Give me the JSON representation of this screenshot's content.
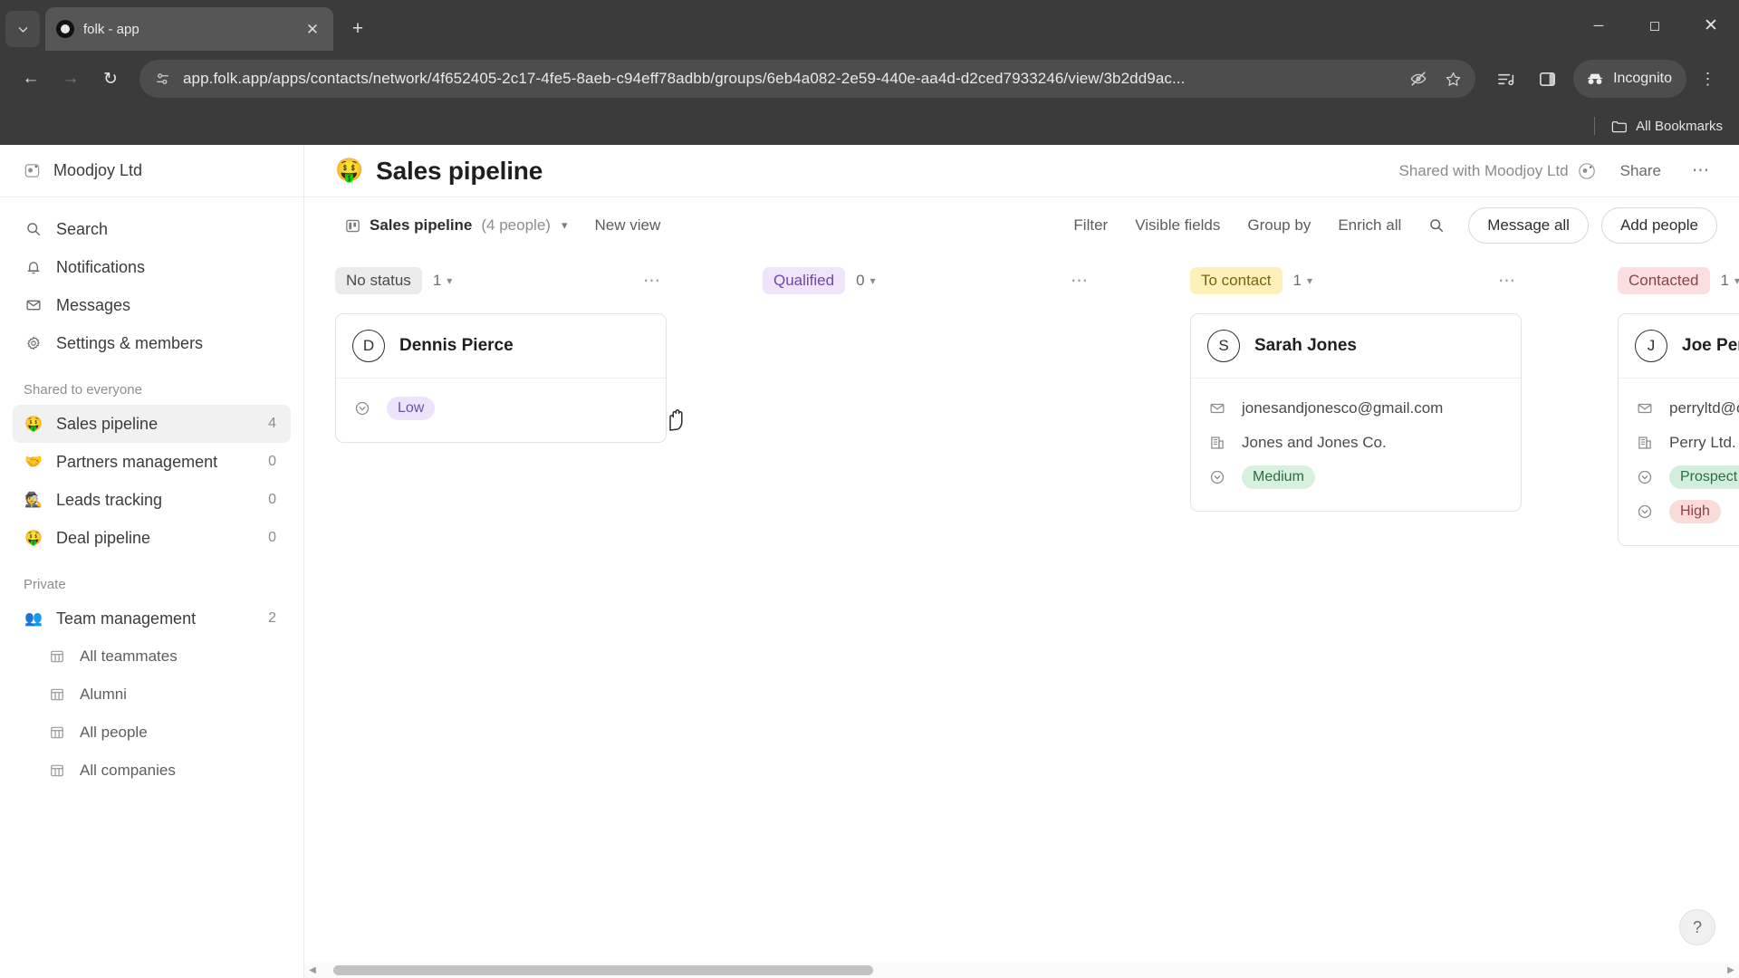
{
  "browser": {
    "tab": {
      "title": "folk - app",
      "favicon_icon": "folk-logo-icon",
      "close_icon": "close-icon"
    },
    "tab_search_icon": "tab-search-chevron-icon",
    "new_tab_icon": "plus-icon",
    "window_controls": {
      "minimize": "minimize-icon",
      "maximize": "maximize-icon",
      "close": "close-icon"
    },
    "nav": {
      "back_icon": "back-arrow-icon",
      "forward_icon": "forward-arrow-icon",
      "reload_icon": "reload-icon"
    },
    "omnibox": {
      "site_info_icon": "page-settings-icon",
      "url": "app.folk.app/apps/contacts/network/4f652405-2c17-4fe5-8aeb-c94eff78adbb/groups/6eb4a082-2e59-440e-aa4d-d2ced7933246/view/3b2dd9ac...",
      "hide_icon": "eye-crossed-icon",
      "bookmark_icon": "star-icon"
    },
    "toolbar_icons": [
      "reading-list-icon",
      "side-panel-icon"
    ],
    "incognito": {
      "label": "Incognito",
      "icon": "incognito-hat-icon"
    },
    "menu_icon": "three-dot-menu-icon",
    "bookmarks_bar": {
      "label": "All Bookmarks",
      "icon": "folder-icon"
    }
  },
  "sidebar": {
    "workspace": {
      "name": "Moodjoy Ltd",
      "logo_icon": "moodjoy-logo-icon"
    },
    "nav": [
      {
        "label": "Search",
        "icon": "search-icon"
      },
      {
        "label": "Notifications",
        "icon": "bell-icon"
      },
      {
        "label": "Messages",
        "icon": "envelope-icon"
      },
      {
        "label": "Settings & members",
        "icon": "gear-icon"
      }
    ],
    "sections": [
      {
        "title": "Shared to everyone",
        "items": [
          {
            "label": "Sales pipeline",
            "emoji": "🤑",
            "count": "4",
            "active": true
          },
          {
            "label": "Partners management",
            "emoji": "🤝",
            "count": "0",
            "active": false
          },
          {
            "label": "Leads tracking",
            "emoji": "🕵️",
            "count": "0",
            "active": false
          },
          {
            "label": "Deal pipeline",
            "emoji": "🤑",
            "count": "0",
            "active": false
          }
        ]
      },
      {
        "title": "Private",
        "items": [
          {
            "label": "Team management",
            "emoji": "👥",
            "count": "2",
            "active": false
          }
        ],
        "subitems": [
          {
            "label": "All teammates",
            "icon": "table-icon"
          },
          {
            "label": "Alumni",
            "icon": "table-icon"
          },
          {
            "label": "All people",
            "icon": "table-icon"
          },
          {
            "label": "All companies",
            "icon": "table-icon"
          }
        ]
      }
    ]
  },
  "header": {
    "emoji": "🤑",
    "title": "Sales pipeline",
    "shared_with": "Shared with Moodjoy Ltd",
    "shared_avatar_emoji": "👤",
    "share_label": "Share",
    "more_icon": "three-dot-menu-icon"
  },
  "toolbar": {
    "view_icon": "board-view-icon",
    "view_name": "Sales pipeline",
    "view_count": "(4 people)",
    "view_caret_icon": "chevron-down-icon",
    "new_view_label": "New view",
    "links": [
      "Filter",
      "Visible fields",
      "Group by",
      "Enrich all"
    ],
    "search_icon": "search-icon",
    "message_all_label": "Message all",
    "add_people_label": "Add people"
  },
  "board": {
    "columns": [
      {
        "status": "No status",
        "status_bg": "#ebebeb",
        "status_fg": "#4a4a4a",
        "count": "1",
        "caret_icon": "chevron-down-icon",
        "more_icon": "three-dot-menu-icon",
        "cards": [
          {
            "initial": "D",
            "name": "Dennis Pierce",
            "fields": [
              {
                "icon": "status-circle-icon",
                "type": "tag",
                "value": "Low",
                "bg": "#ede4fb",
                "fg": "#6b4fa8"
              }
            ]
          }
        ]
      },
      {
        "status": "Qualified",
        "status_bg": "#f0e4fb",
        "status_fg": "#6d4ba3",
        "count": "0",
        "caret_icon": "chevron-down-icon",
        "more_icon": "three-dot-menu-icon",
        "cards": []
      },
      {
        "status": "To contact",
        "status_bg": "#fdf0b8",
        "status_fg": "#7a6410",
        "count": "1",
        "caret_icon": "chevron-down-icon",
        "more_icon": "three-dot-menu-icon",
        "cards": [
          {
            "initial": "S",
            "name": "Sarah Jones",
            "fields": [
              {
                "icon": "envelope-icon",
                "type": "text",
                "value": "jonesandjonesco@gmail.com"
              },
              {
                "icon": "building-icon",
                "type": "text",
                "value": "Jones and Jones Co."
              },
              {
                "icon": "status-circle-icon",
                "type": "tag",
                "value": "Medium",
                "bg": "#d8f0de",
                "fg": "#2f6b43"
              }
            ]
          }
        ]
      },
      {
        "status": "Contacted",
        "status_bg": "#fbdfe0",
        "status_fg": "#8c4247",
        "count": "1",
        "caret_icon": "chevron-down-icon",
        "more_icon": "three-dot-menu-icon",
        "cards": [
          {
            "initial": "J",
            "name": "Joe Perry",
            "fields": [
              {
                "icon": "envelope-icon",
                "type": "text",
                "value": "perryltd@official.com"
              },
              {
                "icon": "building-icon",
                "type": "text",
                "value": "Perry Ltd."
              },
              {
                "icon": "status-circle-icon",
                "type": "tag",
                "value": "Prospect",
                "bg": "#d2eedc",
                "fg": "#2f6b43"
              },
              {
                "icon": "status-circle-icon",
                "type": "tag",
                "value": "High",
                "bg": "#fbdada",
                "fg": "#8c4247"
              }
            ]
          }
        ]
      }
    ]
  },
  "help": {
    "label": "?"
  }
}
